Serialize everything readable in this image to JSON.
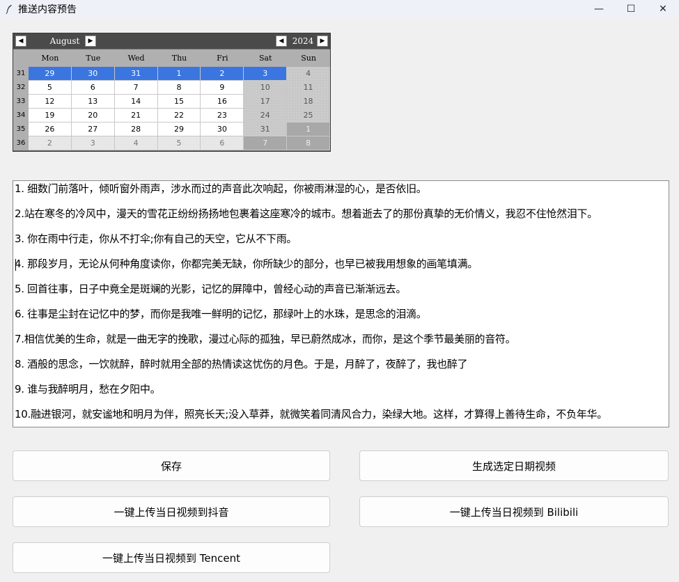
{
  "window": {
    "title": "推送内容预告",
    "minimize": "—",
    "maximize": "☐",
    "close": "✕"
  },
  "calendar": {
    "month": "August",
    "year": "2024",
    "prev_month": "◀",
    "next_month": "▶",
    "prev_year": "◀",
    "next_year": "▶",
    "weekdays": [
      "Mon",
      "Tue",
      "Wed",
      "Thu",
      "Fri",
      "Sat",
      "Sun"
    ],
    "weeks": [
      {
        "num": "31",
        "days": [
          "29",
          "30",
          "31",
          "1",
          "2",
          "3",
          "4"
        ]
      },
      {
        "num": "32",
        "days": [
          "5",
          "6",
          "7",
          "8",
          "9",
          "10",
          "11"
        ]
      },
      {
        "num": "33",
        "days": [
          "12",
          "13",
          "14",
          "15",
          "16",
          "17",
          "18"
        ]
      },
      {
        "num": "34",
        "days": [
          "19",
          "20",
          "21",
          "22",
          "23",
          "24",
          "25"
        ]
      },
      {
        "num": "35",
        "days": [
          "26",
          "27",
          "28",
          "29",
          "30",
          "31",
          "1"
        ]
      },
      {
        "num": "36",
        "days": [
          "2",
          "3",
          "4",
          "5",
          "6",
          "7",
          "8"
        ]
      }
    ],
    "colors": {
      "selected": "#3b75e0",
      "header": "#4a4a4a",
      "weekend": "#c8c8c8"
    }
  },
  "content": {
    "lines": [
      "1. 细数门前落叶，倾听窗外雨声，涉水而过的声音此次响起，你被雨淋湿的心，是否依旧。",
      "2.站在寒冬的冷风中，漫天的雪花正纷纷扬扬地包裹着这座寒冷的城市。想着逝去了的那份真挚的无价情义，我忍不住怆然泪下。",
      "3. 你在雨中行走，你从不打伞;你有自己的天空，它从不下雨。",
      "4. 那段岁月，无论从何种角度读你，你都完美无缺，你所缺少的部分，也早已被我用想象的画笔填满。",
      "5. 回首往事，日子中竟全是斑斓的光影，记忆的屏障中，曾经心动的声音已渐渐远去。",
      "6. 往事是尘封在记忆中的梦，而你是我唯一鲜明的记忆，那绿叶上的水珠，是思念的泪滴。",
      "7.相信优美的生命，就是一曲无字的挽歌，漫过心际的孤独，早已蔚然成冰，而你，是这个季节最美丽的音符。",
      "8. 酒般的思念，一饮就醉，醉时就用全部的热情读这忧伤的月色。于是，月醉了，夜醉了，我也醉了",
      "9. 谁与我醉明月，愁在夕阳中。",
      "10.融进银河，就安谧地和明月为伴，照亮长天;没入草莽，就微笑着同清风合力，染绿大地。这样，才算得上善待生命，不负年华。"
    ]
  },
  "buttons": {
    "save": "保存",
    "generate": "生成选定日期视频",
    "upload_douyin": "一键上传当日视频到抖音",
    "upload_bilibili": "一键上传当日视频到 Bilibili",
    "upload_tencent": "一键上传当日视频到 Tencent"
  }
}
